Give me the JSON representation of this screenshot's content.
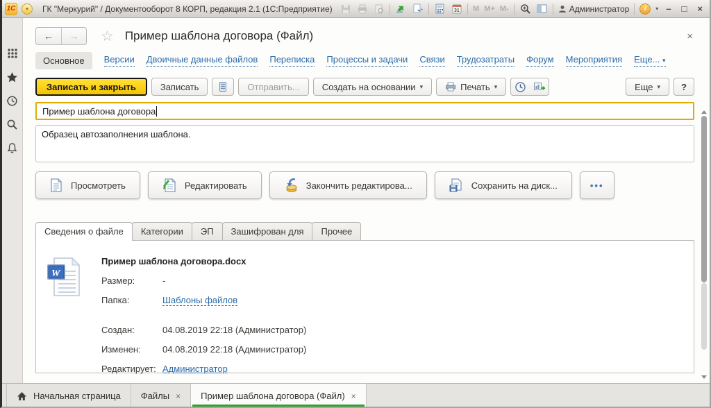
{
  "titlebar": {
    "logo": "1С",
    "title": "ГК \"Меркурий\" / Документооборот 8 КОРП, редакция 2.1  (1С:Предприятие)",
    "memory": [
      "M",
      "M+",
      "M-"
    ],
    "user": "Администратор",
    "info": "i",
    "window_controls": {
      "minimize": "–",
      "maximize": "□",
      "close": "×"
    }
  },
  "icons": {
    "back_arrow": "←",
    "forward_arrow": "→",
    "star_outline": "☆",
    "close": "×",
    "caret_down": "▾",
    "dots": "•••"
  },
  "form": {
    "title": "Пример шаблона договора (Файл)",
    "nav": {
      "active": "Основное",
      "links": [
        "Версии",
        "Двоичные данные файлов",
        "Переписка",
        "Процессы и задачи",
        "Связи",
        "Трудозатраты",
        "Форум",
        "Мероприятия"
      ],
      "more": "Еще..."
    },
    "toolbar": {
      "save_and_close": "Записать и закрыть",
      "save": "Записать",
      "send": "Отправить...",
      "create_from": "Создать на основании",
      "print": "Печать",
      "more": "Еще",
      "help": "?"
    },
    "fields": {
      "name_value": "Пример шаблона договора",
      "description_value": "Образец автозаполнения шаблона."
    },
    "actions": {
      "view": "Просмотреть",
      "edit": "Редактировать",
      "finish_edit": "Закончить редактирова...",
      "save_to_disk": "Сохранить на диск..."
    },
    "tabs": [
      "Сведения о файле",
      "Категории",
      "ЭП",
      "Зашифрован для",
      "Прочее"
    ],
    "file": {
      "name": "Пример шаблона договора.docx",
      "size_label": "Размер:",
      "size_value": "-",
      "folder_label": "Папка:",
      "folder_value": "Шаблоны файлов",
      "created_label": "Создан:",
      "created_value": "04.08.2019 22:18 (Администратор)",
      "modified_label": "Изменен:",
      "modified_value": "04.08.2019 22:18 (Администратор)",
      "editor_label": "Редактирует:",
      "editor_value": "Администратор"
    }
  },
  "taskbar": {
    "home": "Начальная страница",
    "files": "Файлы",
    "current": "Пример шаблона договора (Файл)"
  },
  "colors": {
    "primary_button": "#f5c400",
    "focus_border": "#e3aa00",
    "link": "#2b6ba8",
    "active_tab_underline": "#2fa12f"
  }
}
